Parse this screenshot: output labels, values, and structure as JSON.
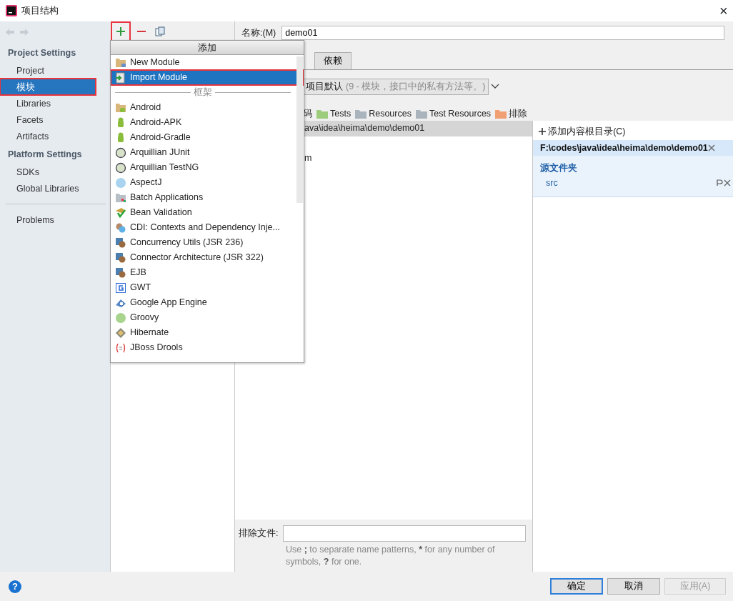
{
  "window": {
    "title": "项目结构",
    "close": "×"
  },
  "sidebar": {
    "sections": [
      {
        "title": "Project Settings",
        "items": [
          {
            "label": "Project",
            "selected": false,
            "highlighted": false
          },
          {
            "label": "模块",
            "selected": true,
            "highlighted": true
          },
          {
            "label": "Libraries",
            "selected": false,
            "highlighted": false
          },
          {
            "label": "Facets",
            "selected": false,
            "highlighted": false
          },
          {
            "label": "Artifacts",
            "selected": false,
            "highlighted": false
          }
        ]
      },
      {
        "title": "Platform Settings",
        "items": [
          {
            "label": "SDKs",
            "selected": false,
            "highlighted": false
          },
          {
            "label": "Global Libraries",
            "selected": false,
            "highlighted": false
          }
        ]
      },
      {
        "items": [
          {
            "label": "Problems",
            "selected": false,
            "highlighted": false
          }
        ]
      }
    ]
  },
  "toolbar": [
    {
      "kind": "add",
      "highlighted": true
    },
    {
      "kind": "remove",
      "highlighted": false
    },
    {
      "kind": "copy",
      "highlighted": false
    }
  ],
  "popup": {
    "title": "添加",
    "items": [
      {
        "kind": "item",
        "label": "New Module",
        "selected": false,
        "highlighted": false
      },
      {
        "kind": "item",
        "label": "Import Module",
        "selected": true,
        "highlighted": true
      },
      {
        "kind": "separator",
        "label": "框架"
      },
      {
        "kind": "item",
        "label": "Android",
        "selected": false,
        "highlighted": false
      },
      {
        "kind": "item",
        "label": "Android-APK",
        "selected": false,
        "highlighted": false
      },
      {
        "kind": "item",
        "label": "Android-Gradle",
        "selected": false,
        "highlighted": false
      },
      {
        "kind": "item",
        "label": "Arquillian JUnit",
        "selected": false,
        "highlighted": false
      },
      {
        "kind": "item",
        "label": "Arquillian TestNG",
        "selected": false,
        "highlighted": false
      },
      {
        "kind": "item",
        "label": "AspectJ",
        "selected": false,
        "highlighted": false
      },
      {
        "kind": "item",
        "label": "Batch Applications",
        "selected": false,
        "highlighted": false
      },
      {
        "kind": "item",
        "label": "Bean Validation",
        "selected": false,
        "highlighted": false
      },
      {
        "kind": "item",
        "label": "CDI: Contexts and Dependency Inje...",
        "selected": false,
        "highlighted": false
      },
      {
        "kind": "item",
        "label": "Concurrency Utils (JSR 236)",
        "selected": false,
        "highlighted": false
      },
      {
        "kind": "item",
        "label": "Connector Architecture (JSR 322)",
        "selected": false,
        "highlighted": false
      },
      {
        "kind": "item",
        "label": "EJB",
        "selected": false,
        "highlighted": false
      },
      {
        "kind": "item",
        "label": "GWT",
        "selected": false,
        "highlighted": false
      },
      {
        "kind": "item",
        "label": "Google App Engine",
        "selected": false,
        "highlighted": false
      },
      {
        "kind": "item",
        "label": "Groovy",
        "selected": false,
        "highlighted": false
      },
      {
        "kind": "item",
        "label": "Hibernate",
        "selected": false,
        "highlighted": false
      },
      {
        "kind": "item",
        "label": "JBoss Drools",
        "selected": false,
        "highlighted": false
      }
    ]
  },
  "module": {
    "name_label": "名称:(M)",
    "name_value": "demo01",
    "tabs": [
      {
        "label": "依赖",
        "selected": false
      }
    ],
    "language_level": {
      "value": "项目默认",
      "hint": "(9 - 模块，接口中的私有方法等。)"
    },
    "folder_types": [
      {
        "label": "码"
      },
      {
        "label": "Tests",
        "color": "#9ccc7c"
      },
      {
        "label": "Resources",
        "color": "#aab4bd"
      },
      {
        "label": "Test Resources",
        "color": "#aab4bd"
      },
      {
        "label": "排除",
        "color": "#f0a072"
      }
    ],
    "tree": [
      {
        "label": "ava\\idea\\heima\\demo\\demo01",
        "selected": true
      },
      {
        "label": "m",
        "selected": false
      }
    ],
    "exclude": {
      "label": "排除文件:",
      "hint": [
        {
          "text": "Use ",
          "bold": false
        },
        {
          "text": ";",
          "bold": true
        },
        {
          "text": " to separate name patterns, ",
          "bold": false
        },
        {
          "text": "*",
          "bold": true
        },
        {
          "text": " for any number of symbols, ",
          "bold": false
        },
        {
          "text": "?",
          "bold": true
        },
        {
          "text": " for one.",
          "bold": false
        }
      ]
    },
    "content_root": {
      "add_label": "添加内容根目录(C)",
      "path": "F:\\codes\\java\\idea\\heima\\demo\\demo01",
      "source_title": "源文件夹",
      "sources": [
        "src"
      ]
    }
  },
  "help": "?",
  "buttons": [
    {
      "label": "确定",
      "default": true,
      "disabled": false
    },
    {
      "label": "取消",
      "default": false,
      "disabled": false
    },
    {
      "label": "应用(A)",
      "default": false,
      "disabled": true
    }
  ]
}
